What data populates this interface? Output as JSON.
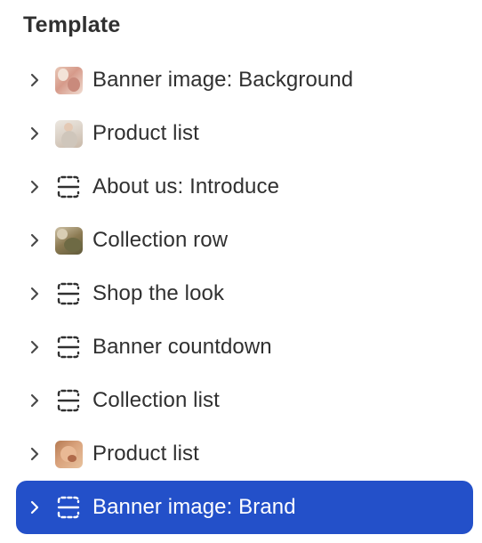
{
  "header": {
    "title": "Template"
  },
  "sections": [
    {
      "label": "Banner image: Background",
      "icon": "image-thumbnail",
      "selected": false
    },
    {
      "label": "Product list",
      "icon": "image-thumbnail",
      "selected": false
    },
    {
      "label": "About us: Introduce",
      "icon": "section-dashed-icon",
      "selected": false
    },
    {
      "label": "Collection row",
      "icon": "image-thumbnail",
      "selected": false
    },
    {
      "label": "Shop the look",
      "icon": "section-dashed-icon",
      "selected": false
    },
    {
      "label": "Banner countdown",
      "icon": "section-dashed-icon",
      "selected": false
    },
    {
      "label": "Collection list",
      "icon": "section-dashed-icon",
      "selected": false
    },
    {
      "label": "Product list",
      "icon": "image-thumbnail",
      "selected": false
    },
    {
      "label": "Banner image: Brand",
      "icon": "section-dashed-icon",
      "selected": true
    }
  ],
  "colors": {
    "selected_background": "#2350c9",
    "text": "#303030",
    "selected_text": "#ffffff"
  }
}
